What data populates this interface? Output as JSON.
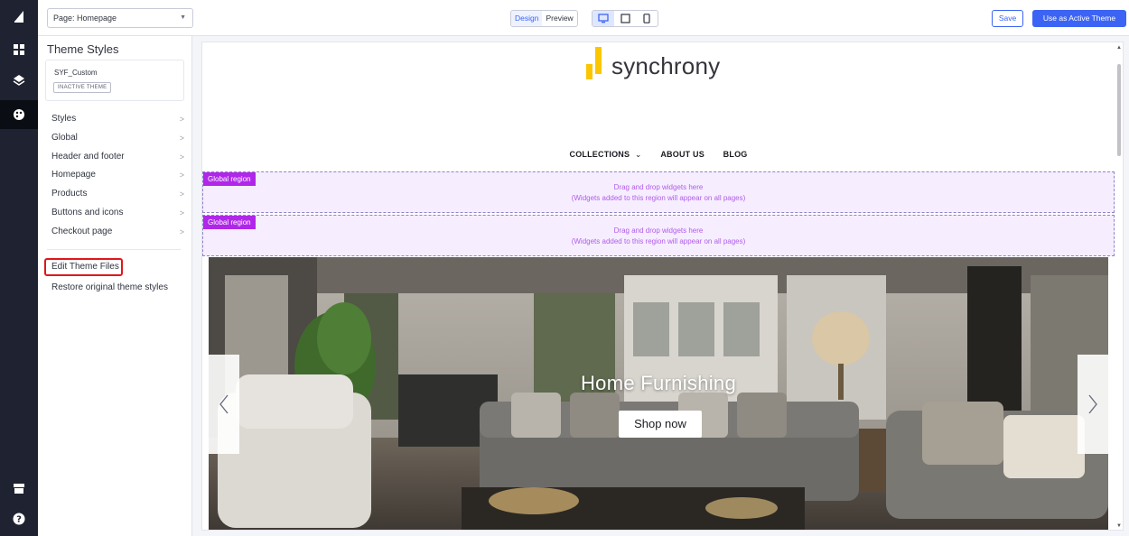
{
  "topbar": {
    "page_select": "Page: Homepage",
    "mode_tabs": [
      "Design",
      "Preview"
    ],
    "save_label": "Save",
    "activate_label": "Use as Active Theme",
    "accent": "#3c64f4"
  },
  "rail": {
    "icons": [
      "bigcommerce-logo-icon",
      "dashboard-icon",
      "layers-icon",
      "palette-icon",
      "storefront-icon",
      "help-icon"
    ]
  },
  "panel": {
    "title": "Theme Styles",
    "theme_name": "SYF_Custom",
    "theme_status": "INACTIVE THEME",
    "menu": [
      {
        "label": "Styles"
      },
      {
        "label": "Global"
      },
      {
        "label": "Header and footer"
      },
      {
        "label": "Homepage"
      },
      {
        "label": "Products"
      },
      {
        "label": "Buttons and icons"
      },
      {
        "label": "Checkout page"
      }
    ],
    "edit_files": "Edit Theme Files",
    "restore": "Restore original theme styles"
  },
  "preview": {
    "brand": "synchrony",
    "nav": [
      "COLLECTIONS",
      "ABOUT US",
      "BLOG"
    ],
    "regions": [
      {
        "tag": "Global region",
        "line1": "Drag and drop widgets here",
        "line2": "(Widgets added to this region will appear on all pages)"
      },
      {
        "tag": "Global region",
        "line1": "Drag and drop widgets here",
        "line2": "(Widgets added to this region will appear on all pages)"
      }
    ],
    "hero": {
      "title": "Home Furnishing",
      "button": "Shop now"
    }
  }
}
